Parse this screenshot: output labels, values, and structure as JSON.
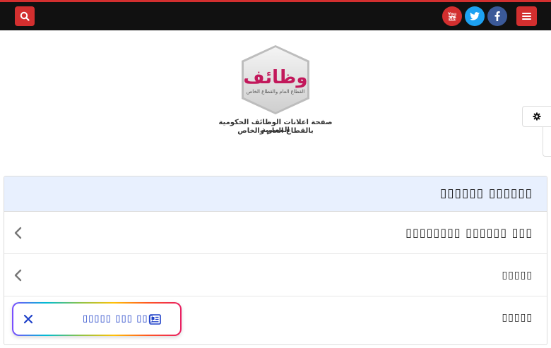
{
  "nav": {
    "search_icon": "search-icon",
    "menu_icon": "menu-icon",
    "social": [
      {
        "name": "youtube-icon",
        "color": "#d32f2f"
      },
      {
        "name": "twitter-icon",
        "color": "#1da1f2"
      },
      {
        "name": "facebook-icon",
        "color": "#3b5998"
      }
    ],
    "accent_color": "#d32f2f"
  },
  "logo": {
    "main": "وظائف",
    "sub": "القطاع العام والقطاع الخاص",
    "line1": "صفحة اعلانات الوظائف الحكومية المصرية",
    "line2": "بالقطاع العام والخاص"
  },
  "card": {
    "title": "▯▯▯▯▯▯ ▯▯▯▯▯▯",
    "rows": [
      {
        "label": "▯▯▯▯▯▯▯▯ ▯▯▯▯▯▯ ▯▯▯"
      },
      {
        "label": "▯▯▯▯▯"
      },
      {
        "label": "▯▯▯▯▯"
      }
    ]
  },
  "floating": {
    "label": "▯▯▯▯▯ ▯▯▯ ▯▯▯",
    "close_icon": "close-icon",
    "news_icon": "newspaper-icon"
  }
}
